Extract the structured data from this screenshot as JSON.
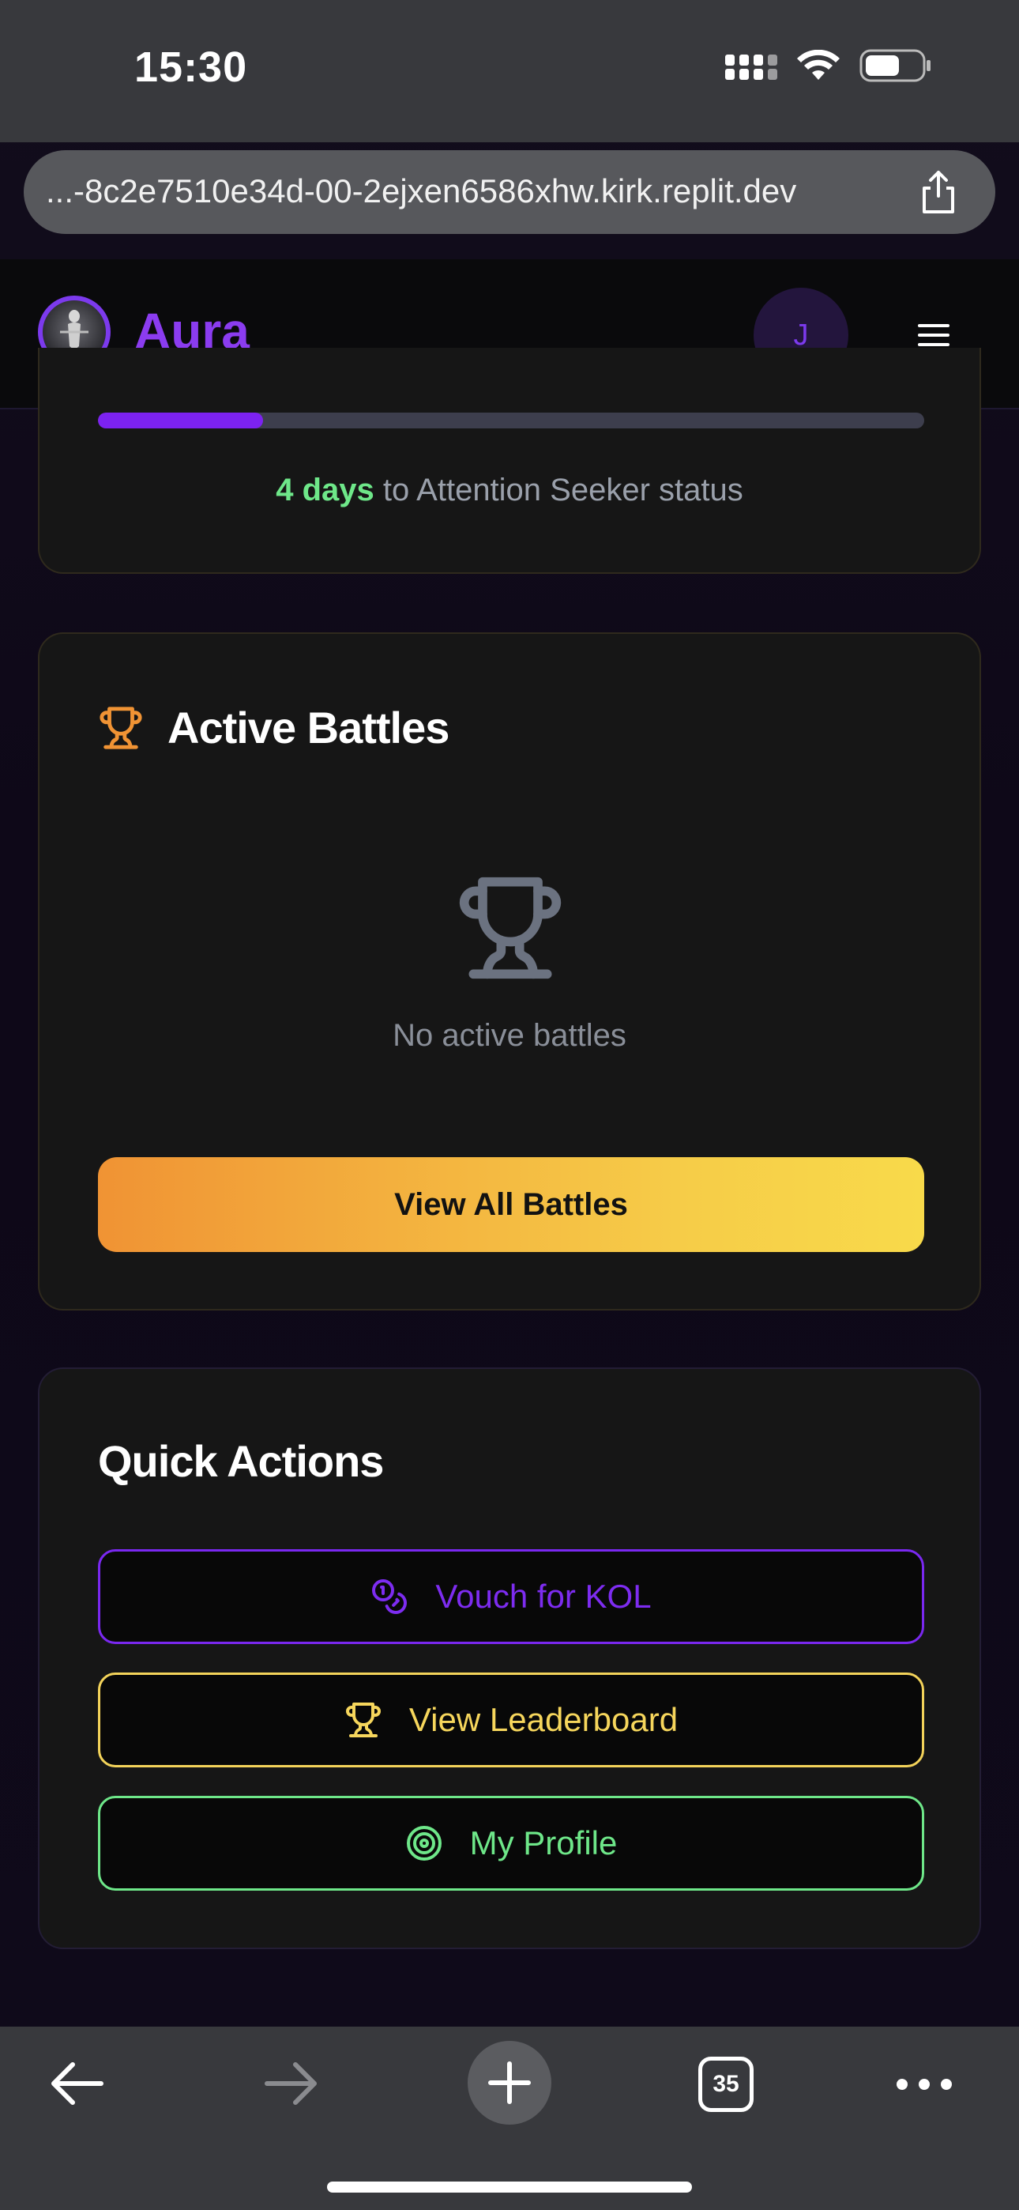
{
  "status_bar": {
    "time": "15:30"
  },
  "browser": {
    "url": "...-8c2e7510e34d-00-2ejxen6586xhw.kirk.replit.dev",
    "tab_count": "35"
  },
  "header": {
    "brand": "Aura",
    "avatar_initial": "J"
  },
  "progress": {
    "fraction": 0.2,
    "days": "4 days",
    "suffix": " to Attention Seeker status"
  },
  "battles": {
    "title": "Active Battles",
    "empty_text": "No active battles",
    "view_all_label": "View All Battles"
  },
  "quick_actions": {
    "title": "Quick Actions",
    "vouch_label": "Vouch for KOL",
    "leaderboard_label": "View Leaderboard",
    "profile_label": "My Profile"
  },
  "colors": {
    "brand_purple": "#7c3aed",
    "accent_green": "#6ee789",
    "accent_yellow": "#f6d65c",
    "accent_orange": "#f09334"
  },
  "icons": [
    "signal-icon",
    "wifi-icon",
    "battery-icon",
    "share-icon",
    "menu-icon",
    "trophy-icon",
    "coins-icon",
    "target-icon",
    "back-arrow-icon",
    "forward-arrow-icon",
    "plus-icon",
    "more-icon"
  ]
}
